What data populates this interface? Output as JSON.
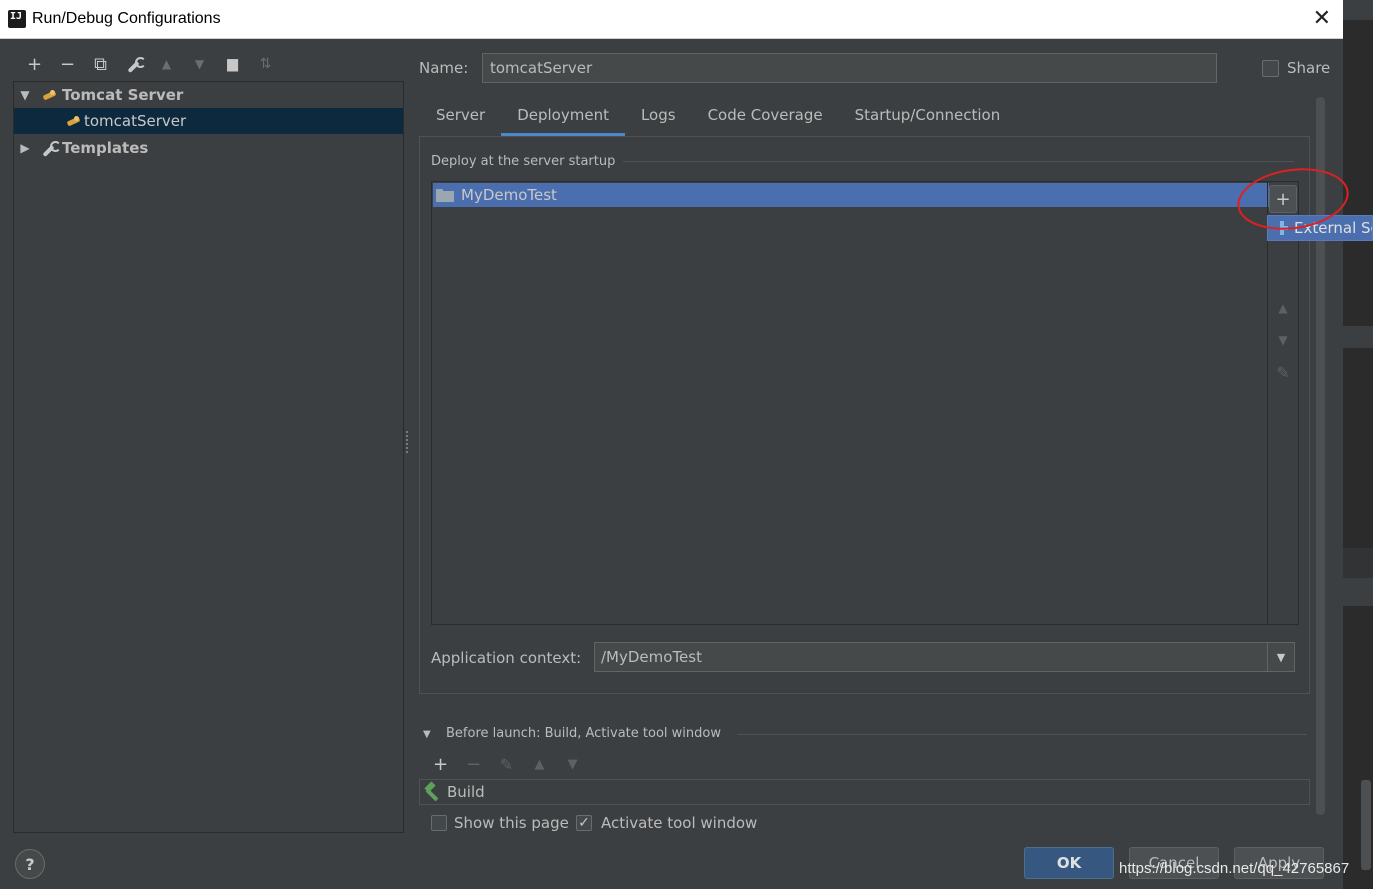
{
  "window": {
    "title": "Run/Debug Configurations",
    "close_glyph": "✕",
    "logo_text": "IJ"
  },
  "left_toolbar": [
    {
      "icon": "plus-icon",
      "glyph": "+"
    },
    {
      "icon": "minus-icon",
      "glyph": "−"
    },
    {
      "icon": "copy-icon",
      "glyph": "⧉"
    },
    {
      "icon": "wrench-icon",
      "glyph": "🔧"
    },
    {
      "icon": "arrow-up-icon",
      "glyph": "▲"
    },
    {
      "icon": "arrow-down-icon",
      "glyph": "▼"
    },
    {
      "icon": "folder-add-icon",
      "glyph": "▆"
    },
    {
      "icon": "sort-icon",
      "glyph": "⇅"
    }
  ],
  "tree": {
    "group_label": "Tomcat Server",
    "child_label": "tomcatServer",
    "templates_label": "Templates",
    "expanded_glyph": "▼",
    "collapsed_glyph": "▶"
  },
  "name": {
    "label": "Name:",
    "value": "tomcatServer"
  },
  "share": {
    "label": "Share",
    "checked": false
  },
  "tabs": [
    {
      "label": "Server",
      "active": false
    },
    {
      "label": "Deployment",
      "active": true
    },
    {
      "label": "Logs",
      "active": false
    },
    {
      "label": "Code Coverage",
      "active": false
    },
    {
      "label": "Startup/Connection",
      "active": false
    }
  ],
  "deployment": {
    "group_label": "Deploy at the server startup",
    "items": [
      "MyDemoTest"
    ],
    "tool_buttons": {
      "add": "+",
      "up": "▲",
      "down": "▼",
      "edit": "✎"
    },
    "popup_item": "External Source...",
    "app_context_label": "Application context:",
    "app_context_value": "/MyDemoTest",
    "combo_arrow": "▼"
  },
  "before_launch": {
    "label": "Before launch: Build, Activate tool window",
    "toggle_glyph": "▼",
    "toolbar": {
      "add": "+",
      "remove": "−",
      "edit": "✎",
      "up": "▲",
      "down": "▼"
    },
    "task": "Build",
    "show_page_label": "Show this page",
    "show_page_checked": false,
    "activate_label": "Activate tool window",
    "activate_checked": true,
    "check_glyph": "✓"
  },
  "buttons": {
    "help": "?",
    "ok": "OK",
    "cancel": "Cancel",
    "apply": "Apply"
  },
  "watermark": "https://blog.csdn.net/qq_42765867",
  "colors": {
    "background": "#3c3f41",
    "selection": "#4b6eaf",
    "tree_selection": "#0d293e",
    "tab_underline": "#4a88c7",
    "annotation_circle": "#e02020",
    "ok_button": "#365880"
  }
}
